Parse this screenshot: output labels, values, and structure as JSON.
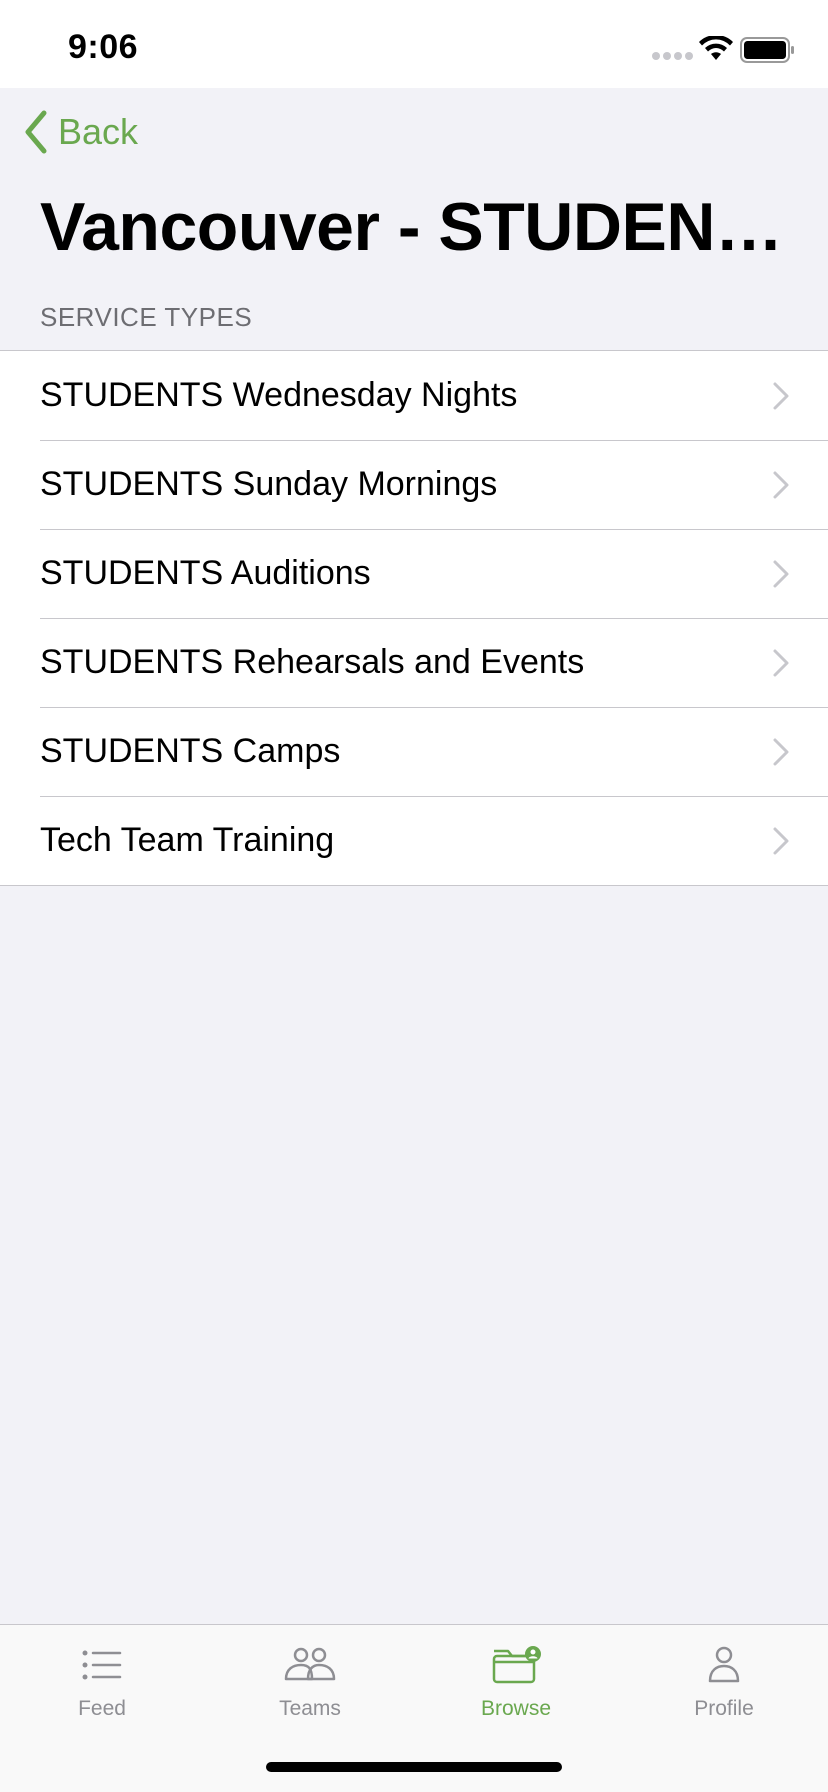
{
  "status_bar": {
    "time": "9:06"
  },
  "nav": {
    "back_label": "Back",
    "title": "Vancouver - STUDENTS"
  },
  "section": {
    "header": "SERVICE TYPES"
  },
  "service_types": [
    {
      "label": "STUDENTS Wednesday Nights"
    },
    {
      "label": "STUDENTS Sunday Mornings"
    },
    {
      "label": "STUDENTS Auditions"
    },
    {
      "label": "STUDENTS Rehearsals and Events"
    },
    {
      "label": "STUDENTS Camps"
    },
    {
      "label": "Tech Team Training"
    }
  ],
  "tab_bar": {
    "active": "browse",
    "tabs": [
      {
        "id": "feed",
        "label": "Feed",
        "icon": "list-icon"
      },
      {
        "id": "teams",
        "label": "Teams",
        "icon": "people-icon"
      },
      {
        "id": "browse",
        "label": "Browse",
        "icon": "folder-person-icon"
      },
      {
        "id": "profile",
        "label": "Profile",
        "icon": "person-icon"
      }
    ]
  },
  "colors": {
    "accent": "#6aa84f",
    "background": "#f2f2f7",
    "inactive_tab": "#8e8e93"
  }
}
